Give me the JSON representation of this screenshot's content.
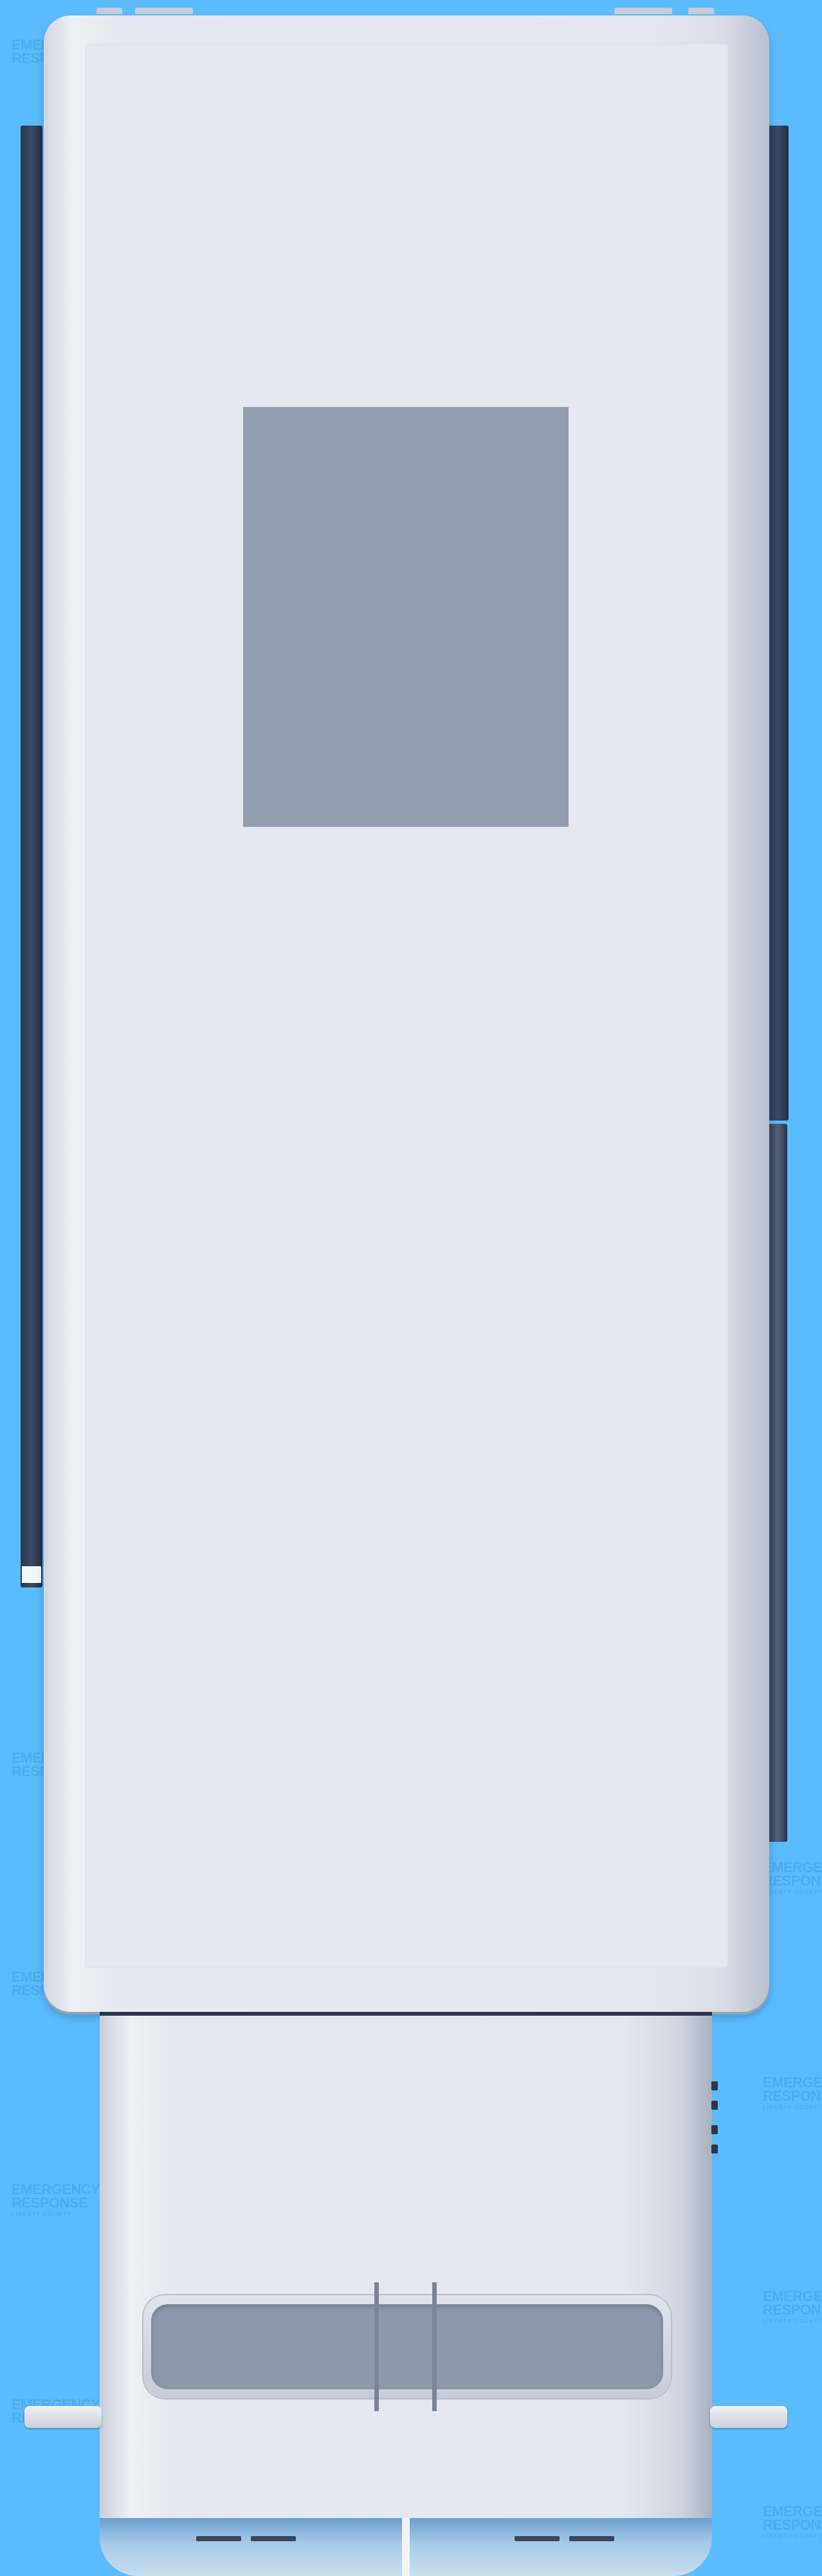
{
  "scene": {
    "background_color": "#5bbcfd",
    "vehicle": "ambulance (top-down view)"
  },
  "watermark": {
    "line1": "EMERGENCY",
    "line2": "RESPONSE",
    "line3": "LIBERTY COUNTY",
    "color": "#3f9fe6"
  },
  "colors": {
    "roof": "#e3e7ef",
    "hatch": "#949eb1",
    "rail": "#2a3850",
    "light_bar": "#8e98ac",
    "windshield": "#a9cbe8"
  }
}
